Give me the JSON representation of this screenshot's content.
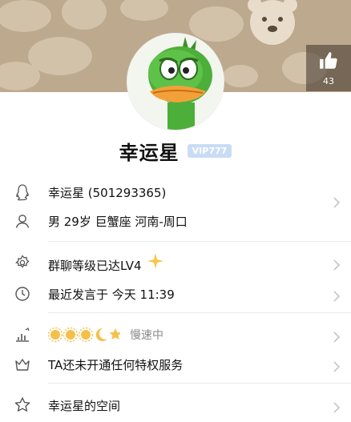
{
  "like": {
    "count": "43"
  },
  "profile": {
    "name": "幸运星",
    "vip": "VIP777"
  },
  "rows": {
    "qq": "幸运星 (501293365)",
    "info": "男 29岁 巨蟹座 河南-周口",
    "group_level": "群聊等级已达LV4",
    "last_speak": "最近发言于 今天 11:39",
    "speed": "慢速中",
    "privilege": "TA还未开通任何特权服务",
    "space": "幸运星的空间"
  },
  "colors": {
    "accent": "#c9dcf5",
    "cover": "#bda98e",
    "chevron": "#c6c6c6",
    "sun": "#f5c04a"
  },
  "icons": [
    "thumbs-up-icon",
    "qq-penguin-icon",
    "person-icon",
    "gear-badge-icon",
    "clock-icon",
    "level-chart-icon",
    "crown-icon",
    "star-icon",
    "sun-icon",
    "moon-icon",
    "sparkle-icon",
    "chevron-right-icon"
  ]
}
